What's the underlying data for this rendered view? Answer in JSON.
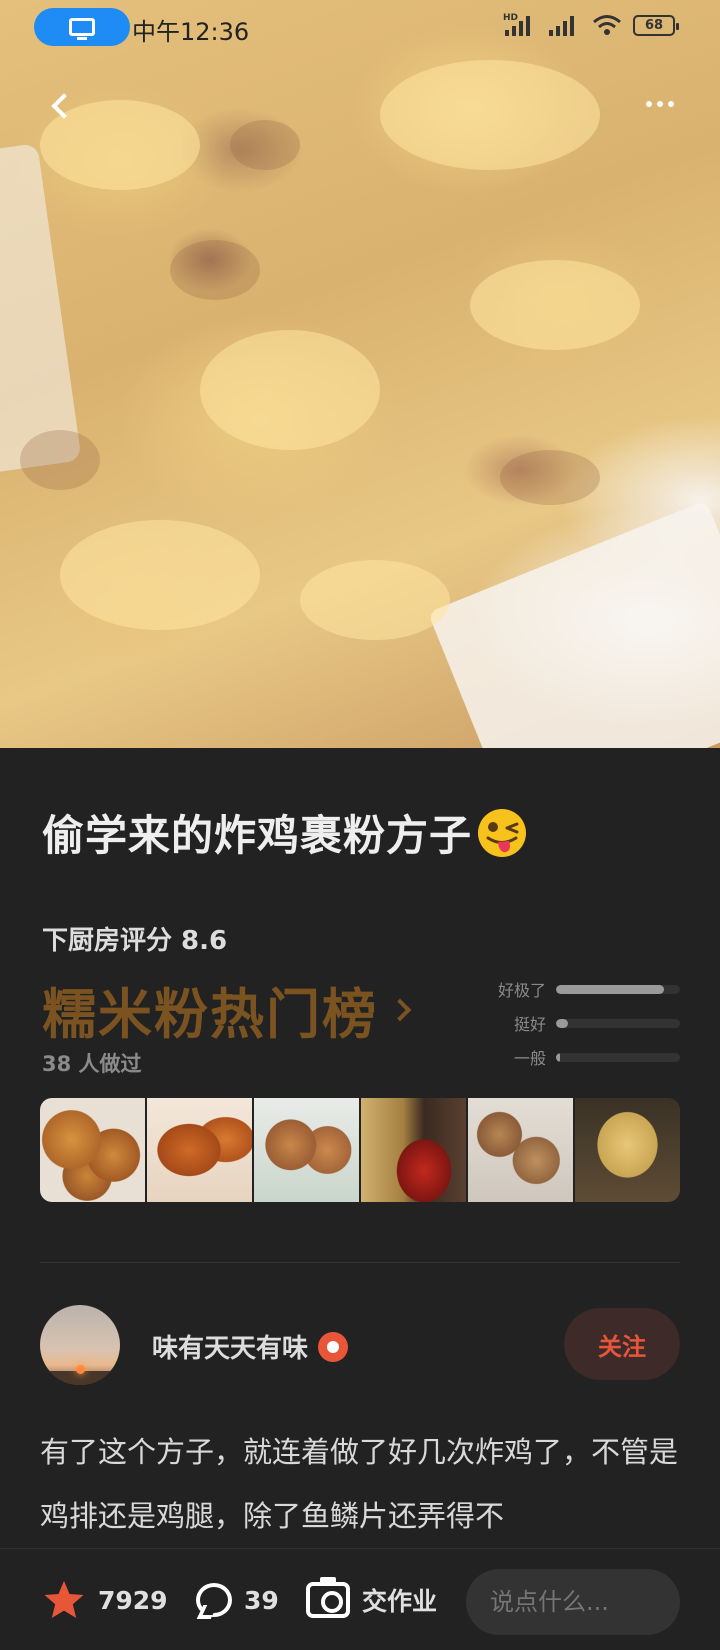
{
  "status_bar": {
    "time": "中午12:36",
    "battery": "68",
    "network_tag": "HD"
  },
  "recipe": {
    "title": "偷学来的炸鸡裹粉方子",
    "score_label": "下厨房评分 8.6",
    "rank_label": "糯米粉热门榜",
    "made_count": "38 人做过",
    "ratings": [
      {
        "label": "好极了",
        "fraction": 0.87
      },
      {
        "label": "挺好",
        "fraction": 0.1
      },
      {
        "label": "一般",
        "fraction": 0.03
      }
    ],
    "dishes": [
      "dish-photo-1",
      "dish-photo-2",
      "dish-photo-3",
      "dish-photo-4",
      "dish-photo-5",
      "dish-photo-6"
    ]
  },
  "author": {
    "name": "味有天天有味",
    "follow_label": "关注"
  },
  "description": "有了这个方子，就连着做了好几次炸鸡了，不管是鸡排还是鸡腿，除了鱼鳞片还弄得不",
  "bottom_bar": {
    "likes": "7929",
    "comments": "39",
    "homework_label": "交作业",
    "comment_placeholder": "说点什么..."
  },
  "colors": {
    "background": "#222222",
    "rank": "#7a5320",
    "accent": "#e8563a",
    "pill": "#1f8cf5"
  }
}
